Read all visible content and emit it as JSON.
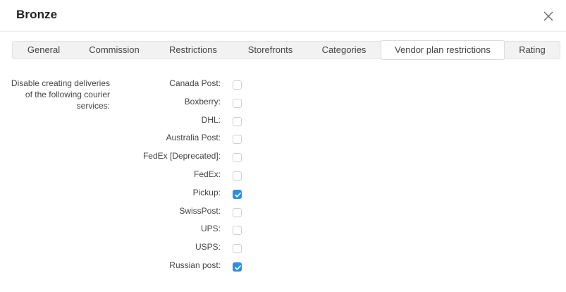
{
  "dialog": {
    "title": "Bronze"
  },
  "tabs": [
    {
      "label": "General",
      "active": false
    },
    {
      "label": "Commission",
      "active": false
    },
    {
      "label": "Restrictions",
      "active": false
    },
    {
      "label": "Storefronts",
      "active": false
    },
    {
      "label": "Categories",
      "active": false
    },
    {
      "label": "Vendor plan restrictions",
      "active": true
    },
    {
      "label": "Rating",
      "active": false
    }
  ],
  "section": {
    "description": "Disable creating deliveries of the following courier services:"
  },
  "couriers": [
    {
      "label": "Canada Post:",
      "checked": false
    },
    {
      "label": "Boxberry:",
      "checked": false
    },
    {
      "label": "DHL:",
      "checked": false
    },
    {
      "label": "Australia Post:",
      "checked": false
    },
    {
      "label": "FedEx [Deprecated]:",
      "checked": false
    },
    {
      "label": "FedEx:",
      "checked": false
    },
    {
      "label": "Pickup:",
      "checked": true
    },
    {
      "label": "SwissPost:",
      "checked": false
    },
    {
      "label": "UPS:",
      "checked": false
    },
    {
      "label": "USPS:",
      "checked": false
    },
    {
      "label": "Russian post:",
      "checked": true
    }
  ],
  "colors": {
    "accent": "#2d8fe0"
  }
}
